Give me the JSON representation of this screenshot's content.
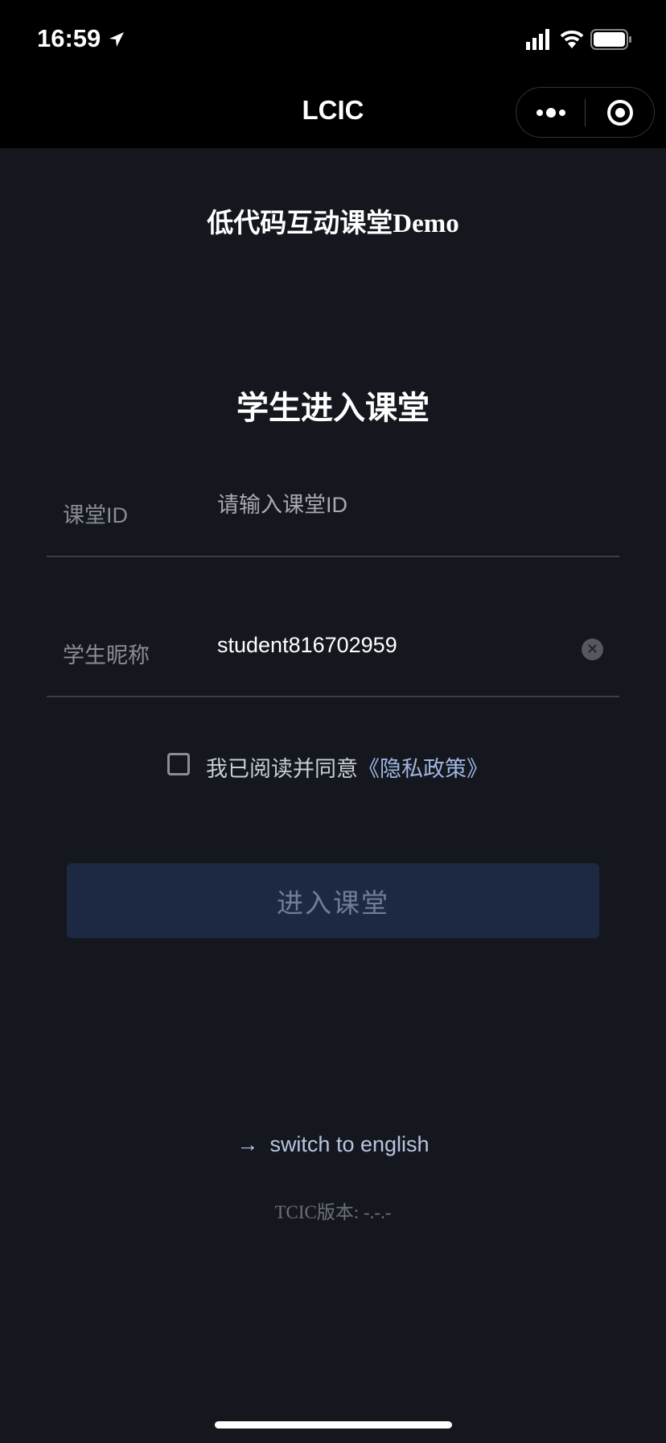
{
  "status_bar": {
    "time": "16:59",
    "icons": [
      "location-arrow-icon",
      "signal-icon",
      "wifi-icon",
      "battery-icon"
    ]
  },
  "nav": {
    "title": "LCIC",
    "more_icon": "more-dots-icon",
    "close_icon": "target-circle-icon"
  },
  "app_title": "低代码互动课堂Demo",
  "form": {
    "heading": "学生进入课堂",
    "class_id": {
      "label": "课堂ID",
      "value": "",
      "placeholder": "请输入课堂ID"
    },
    "nickname": {
      "label": "学生昵称",
      "value": "student816702959"
    },
    "agree_prefix": "我已阅读并同意",
    "agree_link": "《隐私政策》",
    "agree_checked": false,
    "submit": "进入课堂"
  },
  "footer": {
    "switch_icon": "→",
    "switch_label": "switch to english",
    "version": "TCIC版本: -.-.-"
  },
  "colors": {
    "background": "#14171e",
    "button": "#1d2942",
    "link": "#9fb4e0"
  }
}
